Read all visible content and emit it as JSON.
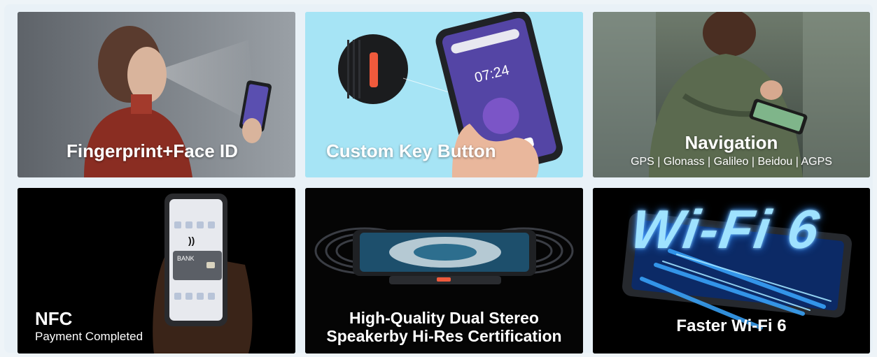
{
  "cards": [
    {
      "id": "fingerprint-face-id",
      "title": "Fingerprint+Face ID"
    },
    {
      "id": "custom-key-button",
      "title": "Custom Key Button",
      "screen_time": "07:24"
    },
    {
      "id": "navigation",
      "title": "Navigation",
      "subtitle": "GPS | Glonass | Galileo | Beidou | AGPS"
    },
    {
      "id": "nfc",
      "title": "NFC",
      "subtitle": "Payment Completed",
      "card_text": "BANK"
    },
    {
      "id": "stereo-speaker",
      "title_line1": "High-Quality Dual Stereo",
      "title_line2": "Speakerby Hi-Res Certification"
    },
    {
      "id": "wifi-6",
      "title": "Faster Wi-Fi 6",
      "big_text": "Wi-Fi 6"
    }
  ],
  "colors": {
    "background": "#e9f1f7",
    "card_blue": "#a6e4f5",
    "accent_orange": "#ef5a3c",
    "wifi_glow": "#2f8dff"
  }
}
